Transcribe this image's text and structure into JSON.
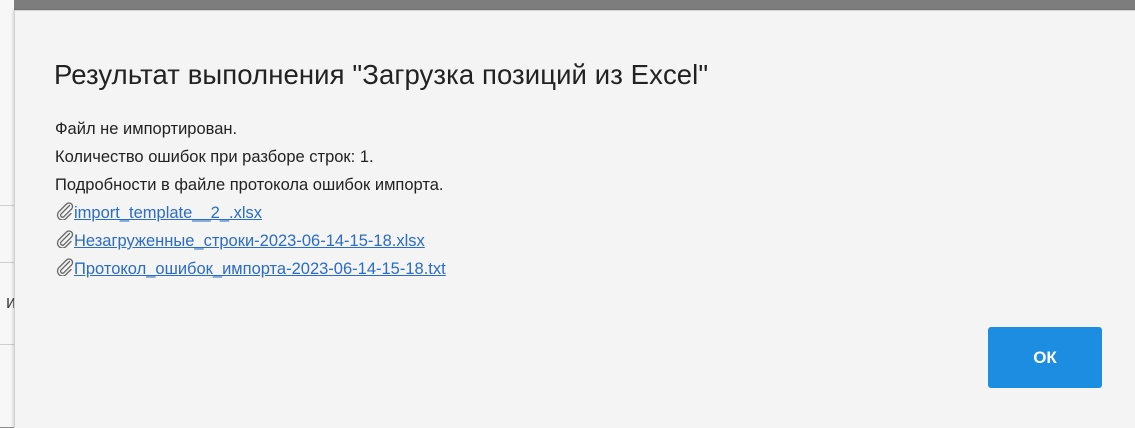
{
  "dialog": {
    "title": "Результат выполнения \"Загрузка позиций из Excel\"",
    "messages": [
      "Файл не импортирован.",
      "Количество ошибок при разборе строк: 1.",
      "Подробности в файле протокола ошибок импорта."
    ],
    "attachments": [
      {
        "label": "import_template__2_.xlsx",
        "icon": "paperclip-icon"
      },
      {
        "label": "Незагруженные_строки-2023-06-14-15-18.xlsx",
        "icon": "paperclip-icon"
      },
      {
        "label": "Протокол_ошибок_импорта-2023-06-14-15-18.txt",
        "icon": "paperclip-icon"
      }
    ],
    "ok_label": "ОК"
  },
  "background": {
    "partial_char": "и"
  },
  "colors": {
    "link": "#2b6cc4",
    "button": "#1c8de0",
    "dialog_bg": "#f4f4f4",
    "overlay": "#7d7d7d"
  }
}
